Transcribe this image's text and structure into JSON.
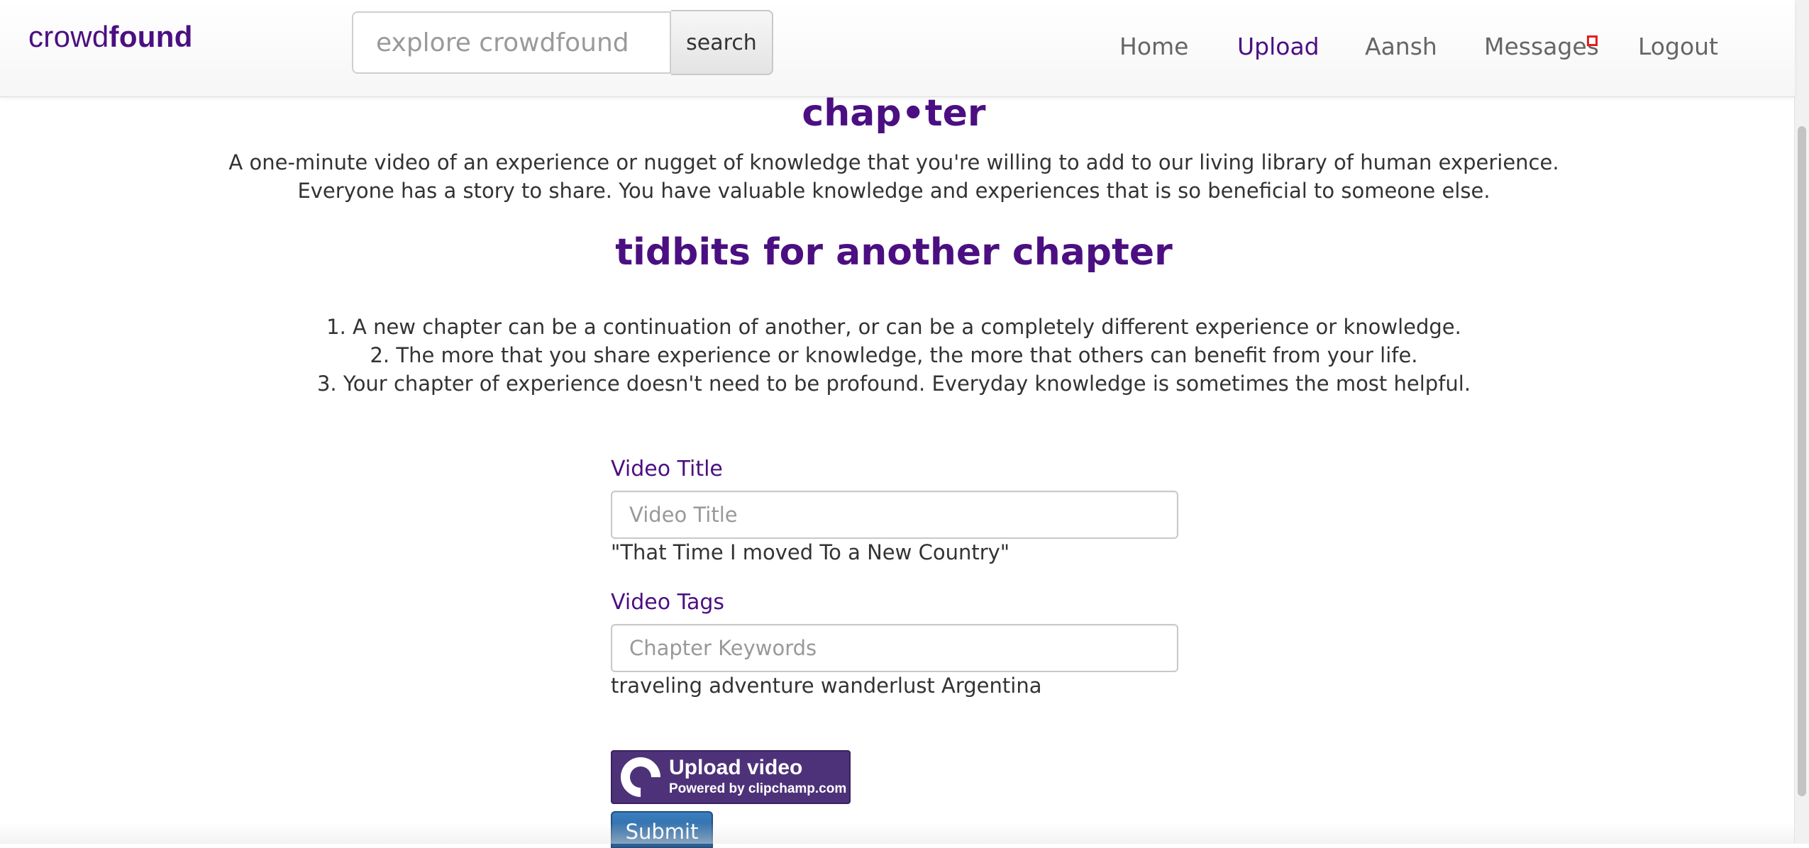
{
  "navbar": {
    "brand_light": "crowd",
    "brand_bold": "found",
    "search_placeholder": "explore crowdfound",
    "search_button": "search",
    "links": [
      {
        "label": "Home"
      },
      {
        "label": "Upload"
      },
      {
        "label": "Aansh"
      },
      {
        "label": "Messages"
      },
      {
        "label": "Logout"
      }
    ],
    "active_link": "Upload"
  },
  "intro": {
    "heading": "chap•ter",
    "line1": "A one-minute video of an experience or nugget of knowledge that you're willing to add to our living library of human experience.",
    "line2": "Everyone has a story to share. You have valuable knowledge and experiences that is so beneficial to someone else."
  },
  "tidbits": {
    "heading": "tidbits for another chapter",
    "items": [
      "1. A new chapter can be a continuation of another, or can be a completely different experience or knowledge.",
      "2. The more that you share experience or knowledge, the more that others can benefit from your life.",
      "3. Your chapter of experience doesn't need to be profound. Everyday knowledge is sometimes the most helpful."
    ]
  },
  "form": {
    "title_label": "Video Title",
    "title_placeholder": "Video Title",
    "title_example": "\"That Time I moved To a New Country\"",
    "tags_label": "Video Tags",
    "tags_placeholder": "Chapter Keywords",
    "tags_example": "traveling adventure wanderlust Argentina",
    "upload_title": "Upload video",
    "upload_sub": "Powered by clipchamp.com",
    "submit": "Submit"
  },
  "colors": {
    "brand": "#4b0f82",
    "badge": "#e02020",
    "upload_button": "#4e3279",
    "submit_button": "#2f6aa6"
  }
}
